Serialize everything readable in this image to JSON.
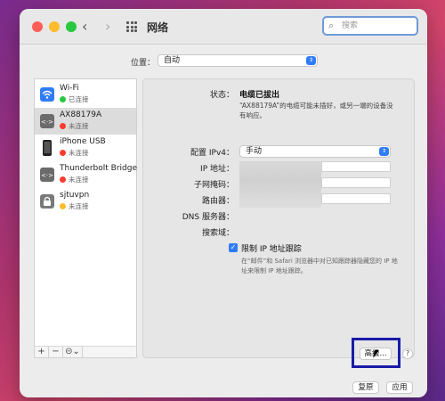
{
  "window": {
    "title": "网络"
  },
  "search": {
    "placeholder": "搜索"
  },
  "location": {
    "label": "位置：",
    "value": "自动"
  },
  "services": [
    {
      "name": "Wi-Fi",
      "status": "已连接",
      "status_color": "#28c840",
      "icon": "wifi-icon"
    },
    {
      "name": "AX88179A",
      "status": "未连接",
      "status_color": "#ff3b30",
      "icon": "ethernet-icon"
    },
    {
      "name": "iPhone USB",
      "status": "未连接",
      "status_color": "#ff3b30",
      "icon": "iphone-icon"
    },
    {
      "name": "Thunderbolt Bridge",
      "status": "未连接",
      "status_color": "#ff3b30",
      "icon": "thunderbolt-bridge-icon"
    },
    {
      "name": "sjtuvpn",
      "status": "未连接",
      "status_color": "#febc2e",
      "icon": "vpn-lock-icon"
    }
  ],
  "toolbar": {
    "add": "+",
    "remove": "−",
    "actions": "⊝⌄"
  },
  "detail": {
    "status_label": "状态：",
    "status_value": "电缆已拔出",
    "status_desc": "“AX88179A”的电缆可能未插好，或另一端的设备没有响应。",
    "config_label": "配置 IPv4：",
    "config_value": "手动",
    "ip_label": "IP 地址：",
    "mask_label": "子网掩码：",
    "router_label": "路由器：",
    "dns_label": "DNS 服务器：",
    "search_domain_label": "搜索域：",
    "limit_tracking_label": "限制 IP 地址跟踪",
    "limit_tracking_checked": true,
    "limit_tracking_note": "在“邮件”和 Safari 浏览器中对已知跟踪器隐藏您的 IP 地址来限制 IP 地址跟踪。"
  },
  "buttons": {
    "advanced": "高级...",
    "help": "?",
    "revert": "复原",
    "apply": "应用"
  }
}
